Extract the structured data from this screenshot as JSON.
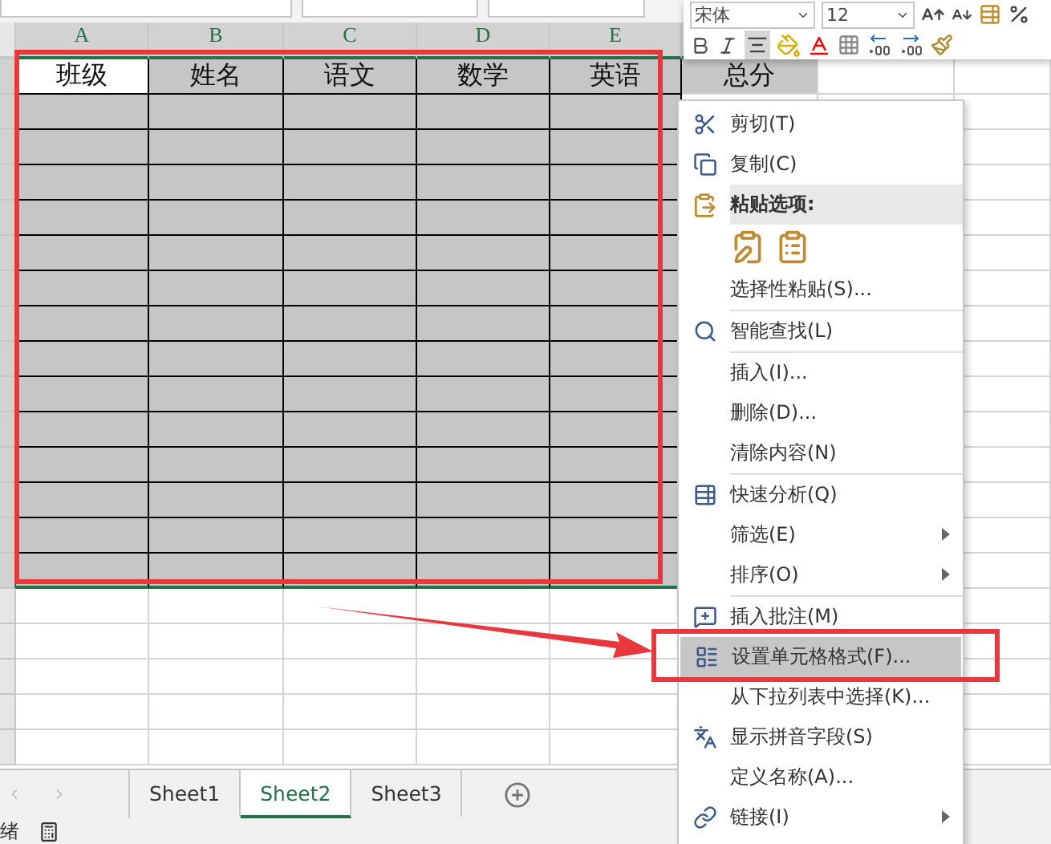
{
  "toolbar": {
    "font": "宋体",
    "size": "12",
    "center_align_active": true
  },
  "columns": [
    "A",
    "B",
    "C",
    "D",
    "E"
  ],
  "header_cells": [
    {
      "text": "班级",
      "active": true
    },
    {
      "text": "姓名",
      "active": false
    },
    {
      "text": "语文",
      "active": false
    },
    {
      "text": "数学",
      "active": false
    },
    {
      "text": "英语",
      "active": false
    },
    {
      "text": "总分",
      "active": false
    }
  ],
  "context_menu": [
    {
      "kind": "item",
      "label": "剪切(T)",
      "separator_before": false,
      "submenu": false,
      "highlighted": false
    },
    {
      "kind": "item",
      "label": "复制(C)",
      "separator_before": false,
      "submenu": false,
      "highlighted": false
    },
    {
      "kind": "heading",
      "label": "粘贴选项:"
    },
    {
      "kind": "paste_icons"
    },
    {
      "kind": "item",
      "label": "选择性粘贴(S)...",
      "separator_before": false,
      "submenu": false,
      "highlighted": false
    },
    {
      "kind": "item",
      "label": "智能查找(L)",
      "separator_before": true,
      "submenu": false,
      "highlighted": false
    },
    {
      "kind": "item",
      "label": "插入(I)...",
      "separator_before": true,
      "submenu": false,
      "highlighted": false
    },
    {
      "kind": "item",
      "label": "删除(D)...",
      "separator_before": false,
      "submenu": false,
      "highlighted": false
    },
    {
      "kind": "item",
      "label": "清除内容(N)",
      "separator_before": false,
      "submenu": false,
      "highlighted": false
    },
    {
      "kind": "item",
      "label": "快速分析(Q)",
      "separator_before": true,
      "submenu": false,
      "highlighted": false
    },
    {
      "kind": "item",
      "label": "筛选(E)",
      "separator_before": false,
      "submenu": true,
      "highlighted": false
    },
    {
      "kind": "item",
      "label": "排序(O)",
      "separator_before": false,
      "submenu": true,
      "highlighted": false
    },
    {
      "kind": "item",
      "label": "插入批注(M)",
      "separator_before": true,
      "submenu": false,
      "highlighted": false
    },
    {
      "kind": "item",
      "label": "设置单元格格式(F)...",
      "separator_before": false,
      "submenu": false,
      "highlighted": true
    },
    {
      "kind": "item",
      "label": "从下拉列表中选择(K)...",
      "separator_before": false,
      "submenu": false,
      "highlighted": false
    },
    {
      "kind": "item",
      "label": "显示拼音字段(S)",
      "separator_before": false,
      "submenu": false,
      "highlighted": false
    },
    {
      "kind": "item",
      "label": "定义名称(A)...",
      "separator_before": false,
      "submenu": false,
      "highlighted": false
    },
    {
      "kind": "item",
      "label": "链接(I)",
      "separator_before": false,
      "submenu": true,
      "highlighted": false
    }
  ],
  "sheet_tabs": [
    {
      "label": "Sheet1",
      "selected": false
    },
    {
      "label": "Sheet2",
      "selected": true
    },
    {
      "label": "Sheet3",
      "selected": false
    }
  ],
  "status_bar": {
    "text": "绪"
  }
}
